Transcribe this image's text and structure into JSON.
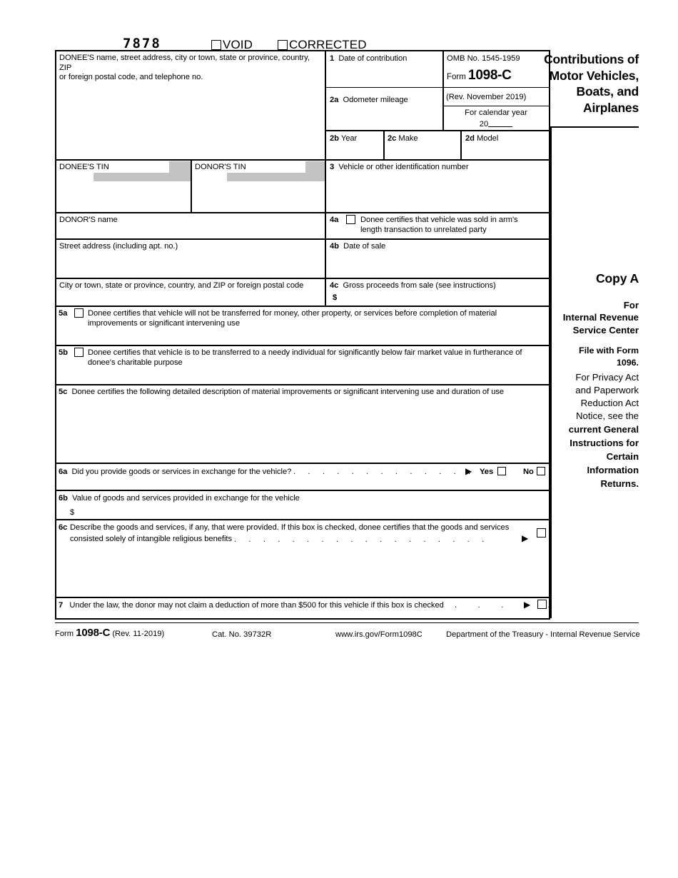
{
  "form": {
    "ocr_number": "7878",
    "void_label": "VOID",
    "corrected_label": "CORRECTED",
    "title_lines": [
      "Contributions of",
      "Motor Vehicles,",
      "Boats, and",
      "Airplanes"
    ],
    "omb_number": "OMB No. 1545-1959",
    "form_word": "Form",
    "form_number": "1098-C",
    "revision": "(Rev. November 2019)",
    "calendar_year_label": "For calendar year",
    "calendar_year_prefix": "20"
  },
  "boxes": {
    "donee_name": {
      "line1": "DONEE'S name, street address, city or town, state or province, country, ZIP",
      "line2": "or foreign postal code, and telephone no."
    },
    "b1": {
      "num": "1",
      "label": "Date of contribution"
    },
    "b2a": {
      "num": "2a",
      "label": "Odometer mileage"
    },
    "b2b": {
      "num": "2b",
      "label": "Year"
    },
    "b2c": {
      "num": "2c",
      "label": "Make"
    },
    "b2d": {
      "num": "2d",
      "label": "Model"
    },
    "donee_tin": "DONEE'S TIN",
    "donor_tin": "DONOR'S TIN",
    "b3": {
      "num": "3",
      "label": "Vehicle or other identification number"
    },
    "donor_name": "DONOR'S name",
    "street_address": "Street address (including apt. no.)",
    "city_state": "City or town, state or province, country, and ZIP or foreign postal code",
    "b4a": {
      "num": "4a",
      "line1": "Donee certifies that vehicle was sold in arm's",
      "line2": "length transaction to unrelated party"
    },
    "b4b": {
      "num": "4b",
      "label": "Date of sale"
    },
    "b4c": {
      "num": "4c",
      "label": "Gross proceeds from sale (see instructions)",
      "currency": "$"
    },
    "b5a": {
      "num": "5a",
      "line1": "Donee certifies that vehicle will not be transferred for money, other property, or services before completion of material",
      "line2": "improvements or significant intervening use"
    },
    "b5b": {
      "num": "5b",
      "line1": "Donee certifies that vehicle is to be transferred to a needy individual for significantly below fair market value in furtherance of",
      "line2": "donee's charitable purpose"
    },
    "b5c": {
      "num": "5c",
      "label": "Donee certifies the following detailed description of material improvements or significant intervening use and duration of use"
    },
    "b6a": {
      "num": "6a",
      "label": "Did you provide goods or services in exchange for the vehicle?",
      "leader": ". . . . . . . . . . . . . .",
      "arrow": "▶",
      "yes": "Yes",
      "no": "No"
    },
    "b6b": {
      "num": "6b",
      "label": "Value of goods and services provided in exchange for the vehicle",
      "currency": "$"
    },
    "b6c": {
      "num": "6c",
      "line1": "Describe the goods and services, if any, that were provided. If this box is checked, donee certifies that the goods and services",
      "line2": "consisted solely of intangible religious benefits",
      "leader": ". . . . . . . . . . . . . . . . . .",
      "arrow": "▶"
    },
    "b7": {
      "num": "7",
      "label": "Under the law, the donor may not claim a deduction of more than $500 for this vehicle if this box is checked",
      "leader": ". . . . .",
      "arrow": "▶"
    }
  },
  "copy_column": {
    "copy_a": "Copy A",
    "for": "For",
    "irs_line1": "Internal Revenue",
    "irs_line2": "Service Center",
    "file_with": "File with Form 1096.",
    "privacy_line1": "For Privacy Act",
    "privacy_line2": "and Paperwork",
    "privacy_line3": "Reduction Act",
    "privacy_line4": "Notice, see the",
    "privacy_line5": "current General",
    "privacy_line6": "Instructions for",
    "privacy_line7": "Certain",
    "privacy_line8": "Information",
    "privacy_line9": "Returns."
  },
  "footer": {
    "form_word": "Form",
    "form_number": "1098-C",
    "revision": "(Rev. 11-2019)",
    "cat_no": "Cat. No. 39732R",
    "website": "www.irs.gov/Form1098C",
    "department": "Department of the Treasury - Internal Revenue Service"
  }
}
